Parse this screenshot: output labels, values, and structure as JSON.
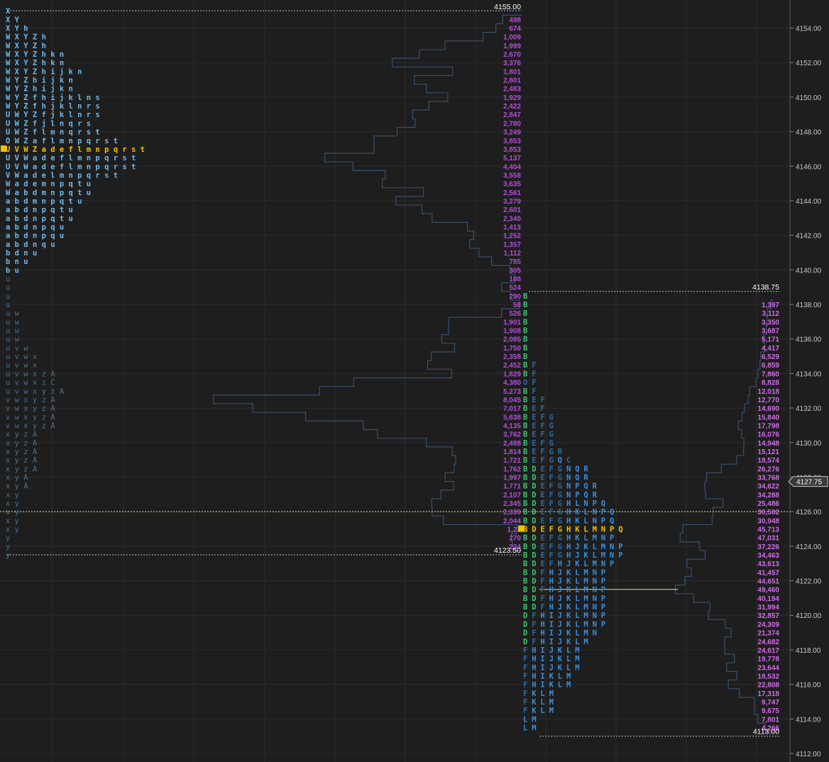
{
  "chart_data": {
    "type": "market_profile",
    "y_axis": {
      "ticks": [
        "4112.00",
        "4114.00",
        "4116.00",
        "4118.00",
        "4120.00",
        "4122.00",
        "4124.00",
        "4126.00",
        "4128.00",
        "4130.00",
        "4132.00",
        "4134.00",
        "4136.00",
        "4138.00",
        "4140.00",
        "4142.00",
        "4144.00",
        "4146.00",
        "4148.00",
        "4150.00",
        "4152.00",
        "4154.00"
      ],
      "current_price": "4127.75",
      "price_min": 4112.0,
      "price_max": 4155.5,
      "row_step": 0.5
    },
    "colors": {
      "background": "#1e1e1e",
      "grid": "#2c2c2c",
      "tpo_light": "#6fb8ea",
      "tpo_dim": "#4a6f8c",
      "tpo_poc": "#f2c200",
      "tpo_green": "#3ec46d",
      "tpo_blue": "#3a8fdc",
      "tpo_blue_dim": "#2f6a9c",
      "volume": "#b14fd6",
      "volume_light": "#d06ee8",
      "vp_line": "#3b4f69",
      "ref_line": "#bdbdbd",
      "va_line": "#d8e98a",
      "poc_marker": "#f2c200",
      "axis_text": "#c8c8c8"
    },
    "profile_1": {
      "high_label": "4155.00",
      "low_label": "4123.50",
      "tpo_rows": [
        {
          "price": 4155.0,
          "letters": "X"
        },
        {
          "price": 4154.5,
          "letters": "X Y"
        },
        {
          "price": 4154.0,
          "letters": "X Y h"
        },
        {
          "price": 4153.5,
          "letters": "W X Y Z h"
        },
        {
          "price": 4153.0,
          "letters": "W X Y Z h"
        },
        {
          "price": 4152.5,
          "letters": "W X Y Z h k n"
        },
        {
          "price": 4152.0,
          "letters": "W X Y Z h k n"
        },
        {
          "price": 4151.5,
          "letters": "W X Y Z h i j k n"
        },
        {
          "price": 4151.0,
          "letters": "W Y Z h i j k n"
        },
        {
          "price": 4150.5,
          "letters": "W Y Z h i j k n"
        },
        {
          "price": 4150.0,
          "letters": "W Y Z f h i j k l n s"
        },
        {
          "price": 4149.5,
          "letters": "W Y Z f h j k l n r s"
        },
        {
          "price": 4149.0,
          "letters": "U W Y Z f j k l n r s"
        },
        {
          "price": 4148.5,
          "letters": "U W Z f j l n q r s"
        },
        {
          "price": 4148.0,
          "letters": "U W Z f l m n q r s t"
        },
        {
          "price": 4147.5,
          "letters": "O W Z a f l m n p q r s t"
        },
        {
          "price": 4147.0,
          "letters": "U V W Z a d e f l m n p q r s t",
          "poc": true
        },
        {
          "price": 4146.5,
          "letters": "U V W a d e f l m n p q r s t"
        },
        {
          "price": 4146.0,
          "letters": "U V W a d e f l m n p q r s t"
        },
        {
          "price": 4145.5,
          "letters": "V W a d e l m n p q r s t"
        },
        {
          "price": 4145.0,
          "letters": "W a d e m n p q t u"
        },
        {
          "price": 4144.5,
          "letters": "W a b d m n p q t u"
        },
        {
          "price": 4144.0,
          "letters": "a b d m n p q t u"
        },
        {
          "price": 4143.5,
          "letters": "a b d n p q t u"
        },
        {
          "price": 4143.0,
          "letters": "a b d n p q t u"
        },
        {
          "price": 4142.5,
          "letters": "a b d n p q u"
        },
        {
          "price": 4142.0,
          "letters": "a b d n p q u"
        },
        {
          "price": 4141.5,
          "letters": "a b d n q u"
        },
        {
          "price": 4141.0,
          "letters": "b d n u"
        },
        {
          "price": 4140.5,
          "letters": "b n u"
        },
        {
          "price": 4140.0,
          "letters": "b u"
        },
        {
          "price": 4139.5,
          "letters": "u"
        },
        {
          "price": 4139.0,
          "letters": "u"
        },
        {
          "price": 4138.5,
          "letters": "u"
        },
        {
          "price": 4138.0,
          "letters": "u"
        },
        {
          "price": 4137.5,
          "letters": "u w"
        },
        {
          "price": 4137.0,
          "letters": "u w"
        },
        {
          "price": 4136.5,
          "letters": "u w"
        },
        {
          "price": 4136.0,
          "letters": "u w"
        },
        {
          "price": 4135.5,
          "letters": "u v w"
        },
        {
          "price": 4135.0,
          "letters": "u v w x"
        },
        {
          "price": 4134.5,
          "letters": "u v w x"
        },
        {
          "price": 4134.0,
          "letters": "u v w x z A"
        },
        {
          "price": 4133.5,
          "letters": "u v w x z C"
        },
        {
          "price": 4133.0,
          "letters": "u v w x y z A"
        },
        {
          "price": 4132.5,
          "letters": "v w x y z A"
        },
        {
          "price": 4132.0,
          "letters": "v w x y z A"
        },
        {
          "price": 4131.5,
          "letters": "v w x y z A"
        },
        {
          "price": 4131.0,
          "letters": "v w x y z A"
        },
        {
          "price": 4130.5,
          "letters": "x y z A"
        },
        {
          "price": 4130.0,
          "letters": "x y z A"
        },
        {
          "price": 4129.5,
          "letters": "x y z A"
        },
        {
          "price": 4129.0,
          "letters": "x y z A"
        },
        {
          "price": 4128.5,
          "letters": "x y z A"
        },
        {
          "price": 4128.0,
          "letters": "x y A"
        },
        {
          "price": 4127.5,
          "letters": "x y A"
        },
        {
          "price": 4127.0,
          "letters": "x y"
        },
        {
          "price": 4126.5,
          "letters": "x y"
        },
        {
          "price": 4126.0,
          "letters": "x y"
        },
        {
          "price": 4125.5,
          "letters": "x y"
        },
        {
          "price": 4125.0,
          "letters": "x y"
        },
        {
          "price": 4124.5,
          "letters": "y"
        },
        {
          "price": 4124.0,
          "letters": "y"
        },
        {
          "price": 4123.5,
          "letters": "y"
        }
      ],
      "volume_rows": [
        {
          "price": 4154.5,
          "value": "498"
        },
        {
          "price": 4154.0,
          "value": "674"
        },
        {
          "price": 4153.5,
          "value": "1,009"
        },
        {
          "price": 4153.0,
          "value": "1,999"
        },
        {
          "price": 4152.5,
          "value": "2,670"
        },
        {
          "price": 4152.0,
          "value": "3,376"
        },
        {
          "price": 4151.5,
          "value": "1,801"
        },
        {
          "price": 4151.0,
          "value": "2,801"
        },
        {
          "price": 4150.5,
          "value": "2,483"
        },
        {
          "price": 4150.0,
          "value": "1,929"
        },
        {
          "price": 4149.5,
          "value": "2,422"
        },
        {
          "price": 4149.0,
          "value": "2,847"
        },
        {
          "price": 4148.5,
          "value": "2,780"
        },
        {
          "price": 4148.0,
          "value": "3,249"
        },
        {
          "price": 4147.5,
          "value": "3,853"
        },
        {
          "price": 4147.0,
          "value": "3,853"
        },
        {
          "price": 4146.5,
          "value": "5,137"
        },
        {
          "price": 4146.0,
          "value": "4,404"
        },
        {
          "price": 4145.5,
          "value": "3,558"
        },
        {
          "price": 4145.0,
          "value": "3,635"
        },
        {
          "price": 4144.5,
          "value": "2,561"
        },
        {
          "price": 4144.0,
          "value": "3,279"
        },
        {
          "price": 4143.5,
          "value": "2,601"
        },
        {
          "price": 4143.0,
          "value": "2,340"
        },
        {
          "price": 4142.5,
          "value": "1,413"
        },
        {
          "price": 4142.0,
          "value": "1,252"
        },
        {
          "price": 4141.5,
          "value": "1,357"
        },
        {
          "price": 4141.0,
          "value": "1,112"
        },
        {
          "price": 4140.5,
          "value": "785"
        },
        {
          "price": 4140.0,
          "value": "305"
        },
        {
          "price": 4139.5,
          "value": "188"
        },
        {
          "price": 4139.0,
          "value": "524"
        },
        {
          "price": 4138.5,
          "value": "290"
        },
        {
          "price": 4138.0,
          "value": "58"
        },
        {
          "price": 4137.5,
          "value": "526"
        },
        {
          "price": 4137.0,
          "value": "1,901"
        },
        {
          "price": 4136.5,
          "value": "1,908"
        },
        {
          "price": 4136.0,
          "value": "2,085"
        },
        {
          "price": 4135.5,
          "value": "1,750"
        },
        {
          "price": 4135.0,
          "value": "2,358"
        },
        {
          "price": 4134.5,
          "value": "2,452"
        },
        {
          "price": 4134.0,
          "value": "1,829"
        },
        {
          "price": 4133.5,
          "value": "4,380"
        },
        {
          "price": 4133.0,
          "value": "5,273"
        },
        {
          "price": 4132.5,
          "value": "8,045"
        },
        {
          "price": 4132.0,
          "value": "7,017"
        },
        {
          "price": 4131.5,
          "value": "5,638"
        },
        {
          "price": 4131.0,
          "value": "4,135"
        },
        {
          "price": 4130.5,
          "value": "3,762"
        },
        {
          "price": 4130.0,
          "value": "2,488"
        },
        {
          "price": 4129.5,
          "value": "1,814"
        },
        {
          "price": 4129.0,
          "value": "1,721"
        },
        {
          "price": 4128.5,
          "value": "1,762"
        },
        {
          "price": 4128.0,
          "value": "1,997"
        },
        {
          "price": 4127.5,
          "value": "1,771"
        },
        {
          "price": 4127.0,
          "value": "2,107"
        },
        {
          "price": 4126.5,
          "value": "2,345"
        },
        {
          "price": 4126.0,
          "value": "2,339"
        },
        {
          "price": 4125.5,
          "value": "2,044"
        },
        {
          "price": 4125.0,
          "value": "1,23"
        },
        {
          "price": 4124.5,
          "value": "270"
        },
        {
          "price": 4124.0,
          "value": "234"
        }
      ]
    },
    "profile_2": {
      "high_label": "4138.75",
      "low_label": "4113.00",
      "tpo_rows": [
        {
          "price": 4138.5,
          "letters": "B"
        },
        {
          "price": 4138.0,
          "letters": "B"
        },
        {
          "price": 4137.5,
          "letters": "B"
        },
        {
          "price": 4137.0,
          "letters": "B"
        },
        {
          "price": 4136.5,
          "letters": "B"
        },
        {
          "price": 4136.0,
          "letters": "B"
        },
        {
          "price": 4135.5,
          "letters": "B"
        },
        {
          "price": 4135.0,
          "letters": "B"
        },
        {
          "price": 4134.5,
          "letters": "B F"
        },
        {
          "price": 4134.0,
          "letters": "B F"
        },
        {
          "price": 4133.5,
          "letters": "O F"
        },
        {
          "price": 4133.0,
          "letters": "B F"
        },
        {
          "price": 4132.5,
          "letters": "B E F"
        },
        {
          "price": 4132.0,
          "letters": "B E F"
        },
        {
          "price": 4131.5,
          "letters": "B E F G"
        },
        {
          "price": 4131.0,
          "letters": "B E F G"
        },
        {
          "price": 4130.5,
          "letters": "B E F G"
        },
        {
          "price": 4130.0,
          "letters": "B E F G"
        },
        {
          "price": 4129.5,
          "letters": "B E F G R"
        },
        {
          "price": 4129.0,
          "letters": "B E F G Q C"
        },
        {
          "price": 4128.5,
          "letters": "B D E F G N Q R"
        },
        {
          "price": 4128.0,
          "letters": "B D E F G N Q R"
        },
        {
          "price": 4127.5,
          "letters": "B D E F G N P Q R"
        },
        {
          "price": 4127.0,
          "letters": "B D E F G N P Q R"
        },
        {
          "price": 4126.5,
          "letters": "B D E F G H L N P Q"
        },
        {
          "price": 4126.0,
          "letters": "B D E F G H K L N P Q"
        },
        {
          "price": 4125.5,
          "letters": "B D E F G H K L N P Q"
        },
        {
          "price": 4125.0,
          "letters": "B D E F G H K L M N P Q",
          "poc": true
        },
        {
          "price": 4124.5,
          "letters": "B D E F G H K L M N P"
        },
        {
          "price": 4124.0,
          "letters": "B D E F G H J K L M N P"
        },
        {
          "price": 4123.5,
          "letters": "B D E F G H J K L M N P"
        },
        {
          "price": 4123.0,
          "letters": "B D E F H J K L M N P"
        },
        {
          "price": 4122.5,
          "letters": "B D F H J K L M N P"
        },
        {
          "price": 4122.0,
          "letters": "B D F H J K L M N P"
        },
        {
          "price": 4121.5,
          "letters": "B D F H J K L M N P"
        },
        {
          "price": 4121.0,
          "letters": "B D F H J K L M N P"
        },
        {
          "price": 4120.5,
          "letters": "B D F H J K L M N P"
        },
        {
          "price": 4120.0,
          "letters": "D F H I J K L M N P"
        },
        {
          "price": 4119.5,
          "letters": "D F H I J K L M N P"
        },
        {
          "price": 4119.0,
          "letters": "D F H I J K L M N"
        },
        {
          "price": 4118.5,
          "letters": "D F H I J K L M"
        },
        {
          "price": 4118.0,
          "letters": "F H I J K L M"
        },
        {
          "price": 4117.5,
          "letters": "F H I J K L M"
        },
        {
          "price": 4117.0,
          "letters": "F H I J K L M"
        },
        {
          "price": 4116.5,
          "letters": "F H I K L M"
        },
        {
          "price": 4116.0,
          "letters": "F H I K L M"
        },
        {
          "price": 4115.5,
          "letters": "F K L M"
        },
        {
          "price": 4115.0,
          "letters": "F K L M"
        },
        {
          "price": 4114.5,
          "letters": "F K L M"
        },
        {
          "price": 4114.0,
          "letters": "L M"
        },
        {
          "price": 4113.5,
          "letters": "L M"
        }
      ],
      "volume_rows": [
        {
          "price": 4138.0,
          "value": "1,397"
        },
        {
          "price": 4137.5,
          "value": "3,112"
        },
        {
          "price": 4137.0,
          "value": "3,350"
        },
        {
          "price": 4136.5,
          "value": "3,687"
        },
        {
          "price": 4136.0,
          "value": "5,171"
        },
        {
          "price": 4135.5,
          "value": "4,417"
        },
        {
          "price": 4135.0,
          "value": "6,529"
        },
        {
          "price": 4134.5,
          "value": "6,859"
        },
        {
          "price": 4134.0,
          "value": "7,860"
        },
        {
          "price": 4133.5,
          "value": "8,828"
        },
        {
          "price": 4133.0,
          "value": "12,018"
        },
        {
          "price": 4132.5,
          "value": "12,770"
        },
        {
          "price": 4132.0,
          "value": "14,690"
        },
        {
          "price": 4131.5,
          "value": "15,840"
        },
        {
          "price": 4131.0,
          "value": "17,798"
        },
        {
          "price": 4130.5,
          "value": "16,076"
        },
        {
          "price": 4130.0,
          "value": "14,948"
        },
        {
          "price": 4129.5,
          "value": "15,121"
        },
        {
          "price": 4129.0,
          "value": "18,574"
        },
        {
          "price": 4128.5,
          "value": "26,276"
        },
        {
          "price": 4128.0,
          "value": "33,768"
        },
        {
          "price": 4127.5,
          "value": "34,622"
        },
        {
          "price": 4127.0,
          "value": "34,288"
        },
        {
          "price": 4126.5,
          "value": "25,486"
        },
        {
          "price": 4126.0,
          "value": "30,502"
        },
        {
          "price": 4125.5,
          "value": "30,948"
        },
        {
          "price": 4125.0,
          "value": "45,713"
        },
        {
          "price": 4124.5,
          "value": "47,031"
        },
        {
          "price": 4124.0,
          "value": "37,226"
        },
        {
          "price": 4123.5,
          "value": "34,463"
        },
        {
          "price": 4123.0,
          "value": "43,613"
        },
        {
          "price": 4122.5,
          "value": "41,457"
        },
        {
          "price": 4122.0,
          "value": "44,651"
        },
        {
          "price": 4121.5,
          "value": "49,460"
        },
        {
          "price": 4121.0,
          "value": "40,194"
        },
        {
          "price": 4120.5,
          "value": "31,994"
        },
        {
          "price": 4120.0,
          "value": "32,857"
        },
        {
          "price": 4119.5,
          "value": "24,309"
        },
        {
          "price": 4119.0,
          "value": "21,374"
        },
        {
          "price": 4118.5,
          "value": "24,682"
        },
        {
          "price": 4118.0,
          "value": "24,617"
        },
        {
          "price": 4117.5,
          "value": "19,778"
        },
        {
          "price": 4117.0,
          "value": "23,644"
        },
        {
          "price": 4116.5,
          "value": "18,532"
        },
        {
          "price": 4116.0,
          "value": "22,808"
        },
        {
          "price": 4115.5,
          "value": "17,318"
        },
        {
          "price": 4115.0,
          "value": "9,747"
        },
        {
          "price": 4114.5,
          "value": "9,675"
        },
        {
          "price": 4114.0,
          "value": "7,801"
        },
        {
          "price": 4113.5,
          "value": "4,266"
        }
      ]
    },
    "reference_lines": [
      {
        "price": 4126.0,
        "style": "dashed",
        "kind": "previous_value"
      },
      {
        "price": 4121.5,
        "style": "solid",
        "kind": "value_area"
      }
    ]
  }
}
